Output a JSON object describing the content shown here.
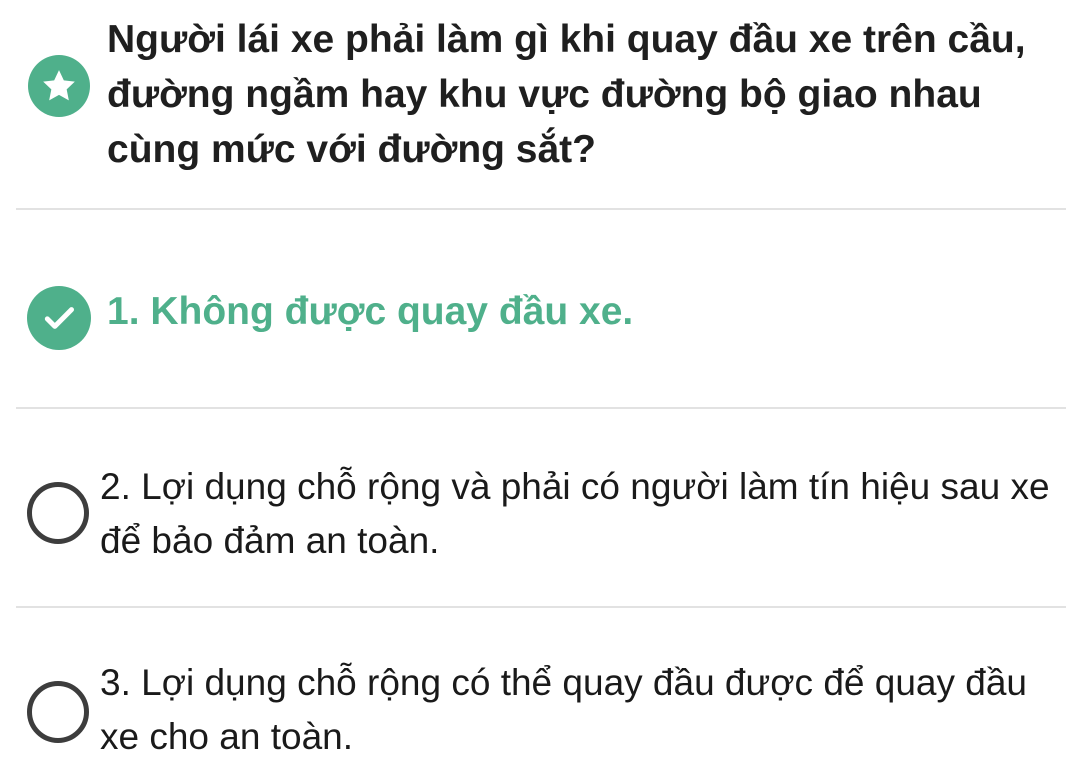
{
  "question": {
    "icon": "star-icon",
    "text": "Người lái xe phải làm gì khi quay đầu xe trên cầu, đường ngầm hay khu vực đường bộ giao nhau cùng mức với đường sắt?"
  },
  "answers": [
    {
      "label": "1. Không được quay đầu xe.",
      "state": "correct",
      "icon": "check-icon"
    },
    {
      "label": "2. Lợi dụng chỗ rộng và phải có người làm tín hiệu sau xe để bảo đảm an toàn.",
      "state": "unselected",
      "icon": "radio-icon"
    },
    {
      "label": "3. Lợi dụng chỗ rộng có thể quay đầu được để quay đầu xe cho an toàn.",
      "state": "unselected",
      "icon": "radio-icon"
    }
  ],
  "colors": {
    "accent": "#4fb08b",
    "text": "#1f1f1f",
    "divider": "#e2e2e2",
    "radio_border": "#3d3d3d"
  }
}
